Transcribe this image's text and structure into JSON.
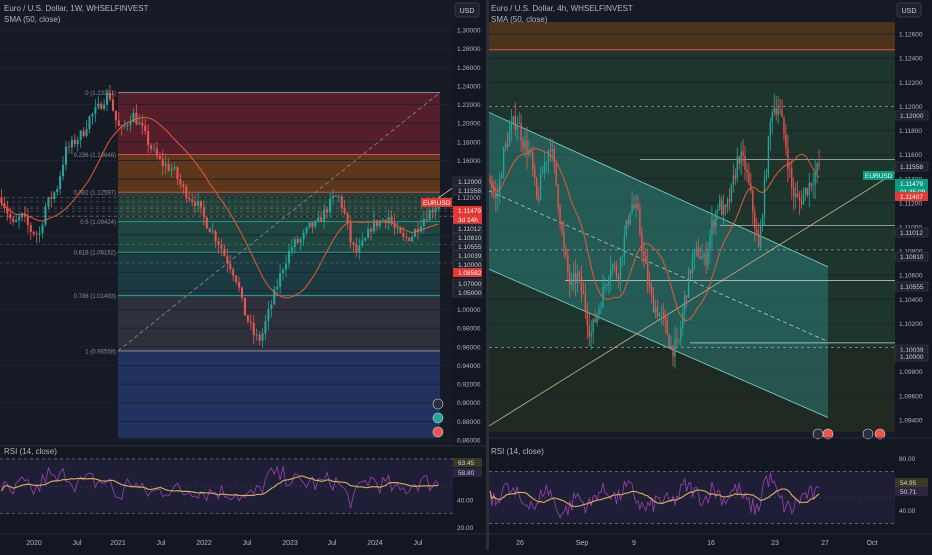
{
  "panels": [
    {
      "title": "Euro / U.S. Dollar, 1W, WHSELFINVEST",
      "indicator": "SMA (50, close)",
      "currency": "USD",
      "price_axis": [
        "1.30000",
        "1.28000",
        "1.26000",
        "1.24000",
        "1.22000",
        "1.20000",
        "1.18000",
        "1.16000",
        "1.14000",
        "1.12000",
        "1.10000",
        "1.08000",
        "1.06000",
        "1.04000",
        "1.02000",
        "1.00000",
        "0.98000",
        "0.96000",
        "0.94000",
        "0.92000",
        "0.90000",
        "0.88000",
        "0.86000"
      ],
      "price_badges": [
        {
          "text": "1.12000",
          "kind": "plain"
        },
        {
          "text": "1.11558",
          "kind": "plain"
        },
        {
          "text": "EURUSD",
          "kind": "red"
        },
        {
          "text": "1.11479",
          "kind": "red"
        },
        {
          "text": "3d 14h",
          "kind": "red"
        },
        {
          "text": "1.11012",
          "kind": "plain"
        },
        {
          "text": "1.10810",
          "kind": "plain"
        },
        {
          "text": "1.10555",
          "kind": "plain"
        },
        {
          "text": "1.10039",
          "kind": "plain"
        },
        {
          "text": "1.10000",
          "kind": "plain"
        },
        {
          "text": "1.08582",
          "kind": "redsmall"
        },
        {
          "text": "1.07000",
          "kind": "plain"
        },
        {
          "text": "1.05000",
          "kind": "plain"
        }
      ],
      "fib_levels": [
        {
          "label": "0 (1.23291)",
          "price": 1.23291
        },
        {
          "label": "0.236 (1.16646)",
          "price": 1.16646
        },
        {
          "label": "0.382 (1.12597)",
          "price": 1.12597
        },
        {
          "label": "0.5 (1.09424)",
          "price": 1.09424
        },
        {
          "label": "0.618 (1.06152)",
          "price": 1.06152
        },
        {
          "label": "0.786 (1.01493)",
          "price": 1.01493
        },
        {
          "label": "1 (0.95558)",
          "price": 0.95558
        }
      ],
      "time_axis": [
        "2020",
        "Jul",
        "2021",
        "Jul",
        "2022",
        "Jul",
        "2023",
        "Jul",
        "2024",
        "Jul"
      ],
      "rsi": {
        "title": "RSI (14, close)",
        "axis": [
          "60.00",
          "40.00",
          "20.00"
        ],
        "badges": [
          "63.45",
          "58.80"
        ]
      }
    },
    {
      "title": "Euro / U.S. Dollar, 4h, WHSELFINVEST",
      "indicator": "SMA (50, close)",
      "currency": "USD",
      "price_axis": [
        "1.12600",
        "1.12400",
        "1.12200",
        "1.12000",
        "1.11800",
        "1.11600",
        "1.11400",
        "1.11200",
        "1.11000",
        "1.10800",
        "1.10600",
        "1.10400",
        "1.10200",
        "1.10000",
        "1.09800",
        "1.09600",
        "1.09400"
      ],
      "price_badges": [
        {
          "text": "1.12000",
          "kind": "plain"
        },
        {
          "text": "1.11558",
          "kind": "plain"
        },
        {
          "text": "EURUSD",
          "kind": "green"
        },
        {
          "text": "1.11479",
          "kind": "green"
        },
        {
          "text": "01:35:09",
          "kind": "green"
        },
        {
          "text": "1.11407",
          "kind": "redsmall"
        },
        {
          "text": "1.11012",
          "kind": "plain"
        },
        {
          "text": "1.10810",
          "kind": "plain"
        },
        {
          "text": "1.10555",
          "kind": "plain"
        },
        {
          "text": "1.10039",
          "kind": "plain"
        },
        {
          "text": "1.10000",
          "kind": "plain"
        }
      ],
      "time_axis": [
        "26",
        "Sep",
        "9",
        "16",
        "23",
        "27",
        "Oct"
      ],
      "rsi": {
        "title": "RSI (14, close)",
        "axis": [
          "80.00",
          "40.00"
        ],
        "badges": [
          "54.95",
          "50.71"
        ]
      }
    }
  ],
  "colors": {
    "background": "#131722",
    "up": "#26a69a",
    "down": "#ef5350",
    "sma": "#e05b3a",
    "rsi_line": "#ab47bc",
    "rsi_ma": "#d9b35a",
    "zone_red": "#5a1e26",
    "zone_orange": "#6b3a1a",
    "zone_green": "#1d4a3a",
    "zone_teal": "#1a4f54",
    "zone_blue": "#1f2f5c",
    "channel": "#2f8a88"
  },
  "chart_data": [
    {
      "type": "candlestick",
      "title": "Euro / U.S. Dollar, 1W, WHSELFINVEST",
      "overlays": [
        "SMA (50, close)",
        "Fibonacci retracement",
        "RSI (14, close)"
      ],
      "x_labels": [
        "2020",
        "Jul",
        "2021",
        "Jul",
        "2022",
        "Jul",
        "2023",
        "Jul",
        "2024",
        "Jul"
      ],
      "ylim": [
        0.86,
        1.3
      ],
      "last_price": 1.11479,
      "close_path": [
        [
          0,
          1.12
        ],
        [
          8,
          1.09
        ],
        [
          14,
          1.1
        ],
        [
          20,
          1.085
        ],
        [
          26,
          1.08
        ],
        [
          30,
          1.11
        ],
        [
          38,
          1.13
        ],
        [
          44,
          1.17
        ],
        [
          50,
          1.18
        ],
        [
          56,
          1.19
        ],
        [
          60,
          1.205
        ],
        [
          66,
          1.215
        ],
        [
          70,
          1.225
        ],
        [
          74,
          1.232
        ],
        [
          78,
          1.205
        ],
        [
          82,
          1.19
        ],
        [
          86,
          1.2
        ],
        [
          90,
          1.21
        ],
        [
          96,
          1.195
        ],
        [
          102,
          1.175
        ],
        [
          108,
          1.16
        ],
        [
          112,
          1.155
        ],
        [
          118,
          1.15
        ],
        [
          124,
          1.13
        ],
        [
          130,
          1.12
        ],
        [
          134,
          1.115
        ],
        [
          138,
          1.1
        ],
        [
          142,
          1.09
        ],
        [
          146,
          1.08
        ],
        [
          150,
          1.07
        ],
        [
          154,
          1.055
        ],
        [
          158,
          1.045
        ],
        [
          162,
          1.03
        ],
        [
          166,
          1.0
        ],
        [
          170,
          0.985
        ],
        [
          174,
          0.97
        ],
        [
          178,
          0.968
        ],
        [
          182,
          0.99
        ],
        [
          188,
          1.02
        ],
        [
          194,
          1.05
        ],
        [
          200,
          1.07
        ],
        [
          206,
          1.075
        ],
        [
          212,
          1.09
        ],
        [
          216,
          1.09
        ],
        [
          220,
          1.1
        ],
        [
          224,
          1.11
        ],
        [
          228,
          1.12
        ],
        [
          232,
          1.12
        ],
        [
          236,
          1.1
        ],
        [
          240,
          1.07
        ],
        [
          244,
          1.06
        ],
        [
          250,
          1.075
        ],
        [
          254,
          1.09
        ],
        [
          260,
          1.095
        ],
        [
          266,
          1.1
        ],
        [
          270,
          1.085
        ],
        [
          276,
          1.075
        ],
        [
          282,
          1.08
        ],
        [
          288,
          1.095
        ],
        [
          294,
          1.105
        ],
        [
          300,
          1.115
        ]
      ]
    },
    {
      "type": "candlestick",
      "title": "Euro / U.S. Dollar, 4h, WHSELFINVEST",
      "overlays": [
        "SMA (50, close)",
        "Descending channel",
        "Ascending trendline",
        "RSI (14, close)"
      ],
      "x_labels": [
        "26",
        "Sep",
        "9",
        "16",
        "23",
        "27",
        "Oct"
      ],
      "ylim": [
        1.093,
        1.127
      ],
      "last_price": 1.11479,
      "close_path": [
        [
          0,
          1.114
        ],
        [
          4,
          1.112
        ],
        [
          8,
          1.116
        ],
        [
          12,
          1.118
        ],
        [
          16,
          1.119
        ],
        [
          20,
          1.117
        ],
        [
          24,
          1.116
        ],
        [
          28,
          1.112
        ],
        [
          32,
          1.115
        ],
        [
          36,
          1.117
        ],
        [
          40,
          1.113
        ],
        [
          44,
          1.108
        ],
        [
          48,
          1.105
        ],
        [
          52,
          1.106
        ],
        [
          56,
          1.104
        ],
        [
          60,
          1.101
        ],
        [
          64,
          1.103
        ],
        [
          68,
          1.105
        ],
        [
          72,
          1.107
        ],
        [
          76,
          1.106
        ],
        [
          80,
          1.109
        ],
        [
          84,
          1.112
        ],
        [
          88,
          1.111
        ],
        [
          92,
          1.107
        ],
        [
          96,
          1.104
        ],
        [
          100,
          1.103
        ],
        [
          104,
          1.102
        ],
        [
          108,
          1.1
        ],
        [
          112,
          1.1
        ],
        [
          116,
          1.104
        ],
        [
          120,
          1.107
        ],
        [
          124,
          1.108
        ],
        [
          128,
          1.107
        ],
        [
          132,
          1.11
        ],
        [
          136,
          1.112
        ],
        [
          140,
          1.111
        ],
        [
          144,
          1.113
        ],
        [
          148,
          1.116
        ],
        [
          152,
          1.115
        ],
        [
          156,
          1.112
        ],
        [
          160,
          1.108
        ],
        [
          164,
          1.114
        ],
        [
          168,
          1.12
        ],
        [
          172,
          1.12
        ],
        [
          176,
          1.117
        ],
        [
          180,
          1.113
        ],
        [
          184,
          1.112
        ],
        [
          188,
          1.113
        ],
        [
          192,
          1.114
        ],
        [
          196,
          1.115
        ]
      ]
    }
  ]
}
